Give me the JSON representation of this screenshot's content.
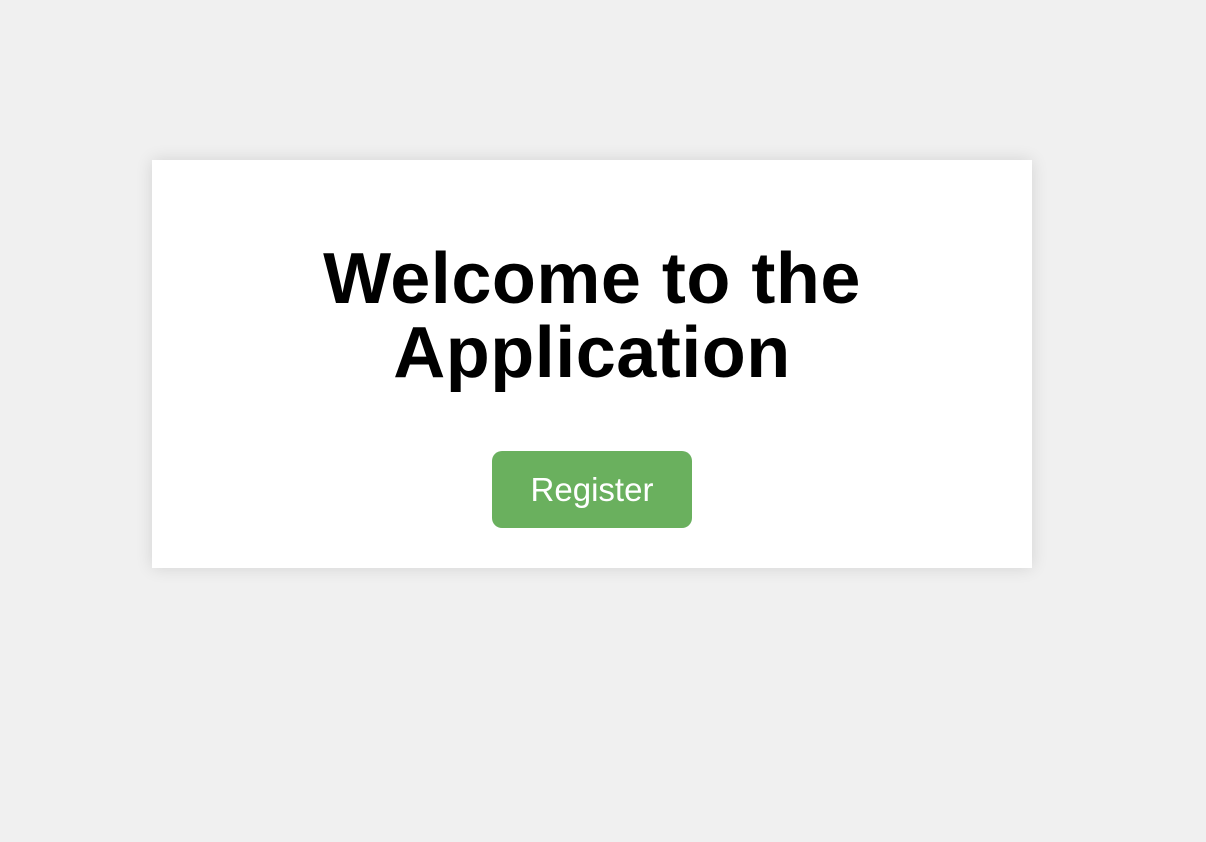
{
  "main": {
    "title_line1": "Welcome to the",
    "title_line2": "Application",
    "register_label": "Register"
  },
  "colors": {
    "page_background": "#f0f0f0",
    "card_background": "#ffffff",
    "button_background": "#6ab05e",
    "button_text": "#ffffff",
    "title_text": "#000000"
  }
}
